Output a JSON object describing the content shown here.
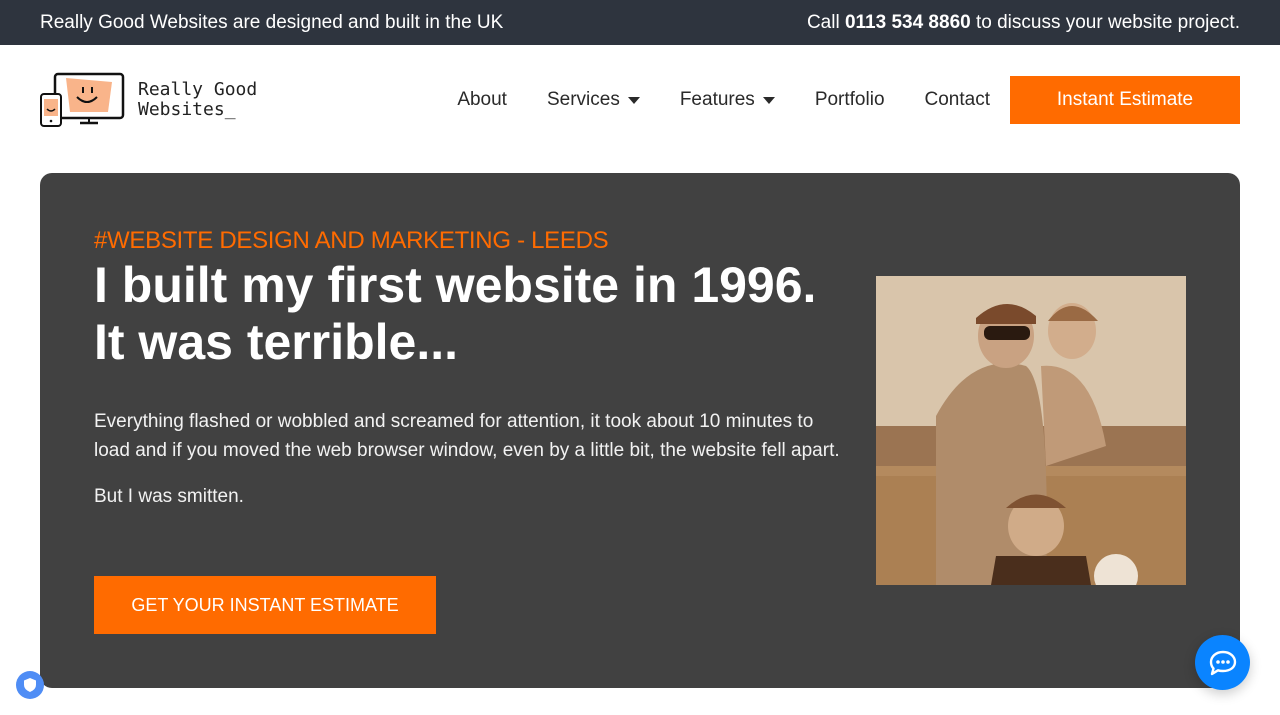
{
  "topbar": {
    "left_text": "Really Good Websites are designed and built in the UK",
    "call_prefix": "Call ",
    "phone": "0113 534 8860",
    "call_suffix": " to discuss your website project."
  },
  "logo": {
    "line1": "Really Good",
    "line2": "Websites_"
  },
  "nav": {
    "items": [
      {
        "label": "About"
      },
      {
        "label": "Services"
      },
      {
        "label": "Features"
      },
      {
        "label": "Portfolio"
      },
      {
        "label": "Contact"
      }
    ],
    "cta_label": "Instant Estimate"
  },
  "hero": {
    "tagline": "#WEBSITE DESIGN AND MARKETING - LEEDS",
    "headline_line1": "I built my first website in 1996.",
    "headline_line2": "It was terrible...",
    "paragraph1": "Everything flashed or wobbled and screamed for attention, it took about 10 minutes to load and if you moved the web browser window, even by a little bit, the website fell apart.",
    "paragraph2": "But I was smitten.",
    "cta_label": "GET YOUR INSTANT ESTIMATE",
    "photo_alt": "Man with two children on a beach"
  },
  "colors": {
    "accent": "#ff6b00",
    "topbar_bg": "#2e343e",
    "hero_bg": "#414141",
    "chat": "#0a84ff",
    "privacy": "#4f8df5"
  }
}
